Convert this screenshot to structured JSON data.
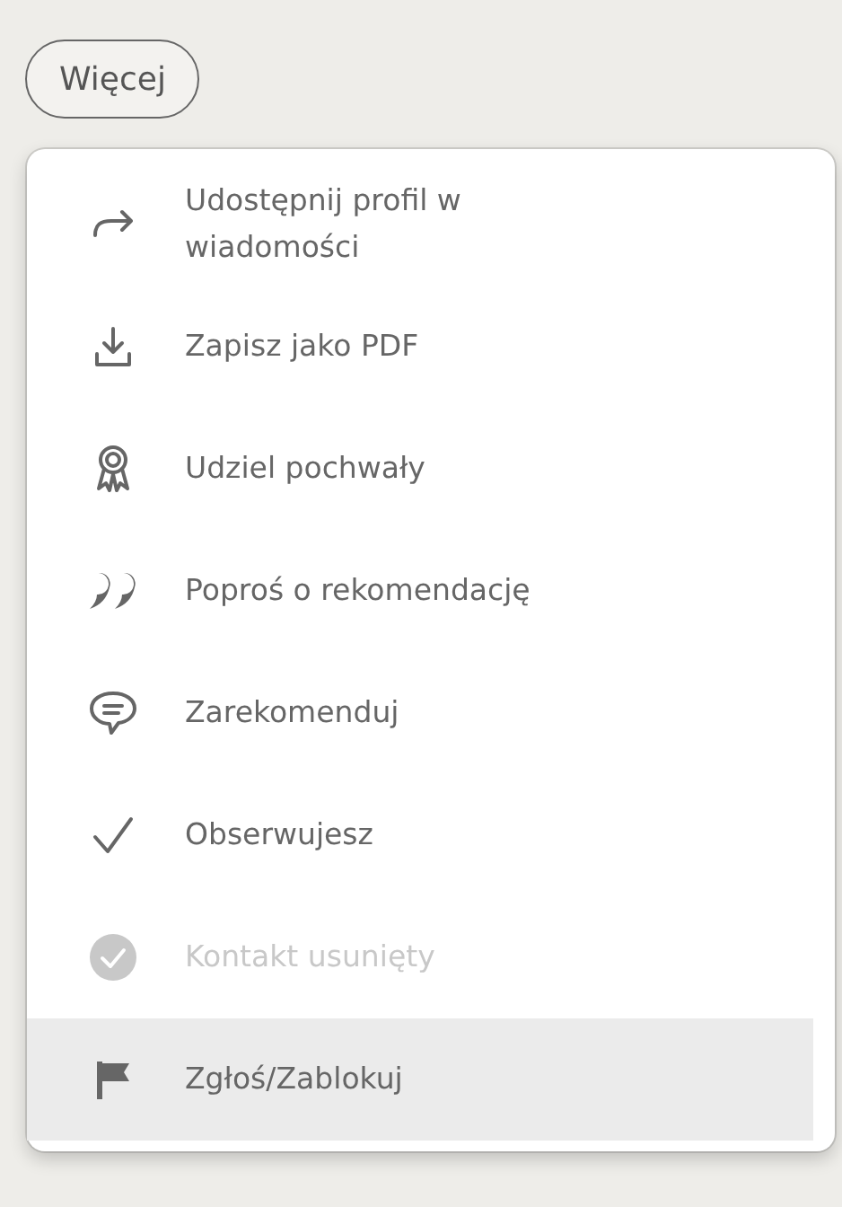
{
  "more_button": {
    "label": "Więcej"
  },
  "menu": {
    "items": [
      {
        "label": "Udostępnij profil w wiadomości",
        "disabled": false,
        "highlighted": false
      },
      {
        "label": "Zapisz jako PDF",
        "disabled": false,
        "highlighted": false
      },
      {
        "label": "Udziel pochwały",
        "disabled": false,
        "highlighted": false
      },
      {
        "label": "Poproś o rekomendację",
        "disabled": false,
        "highlighted": false
      },
      {
        "label": "Zarekomenduj",
        "disabled": false,
        "highlighted": false
      },
      {
        "label": "Obserwujesz",
        "disabled": false,
        "highlighted": false
      },
      {
        "label": "Kontakt usunięty",
        "disabled": true,
        "highlighted": false
      },
      {
        "label": "Zgłoś/Zablokuj",
        "disabled": false,
        "highlighted": true
      }
    ]
  }
}
